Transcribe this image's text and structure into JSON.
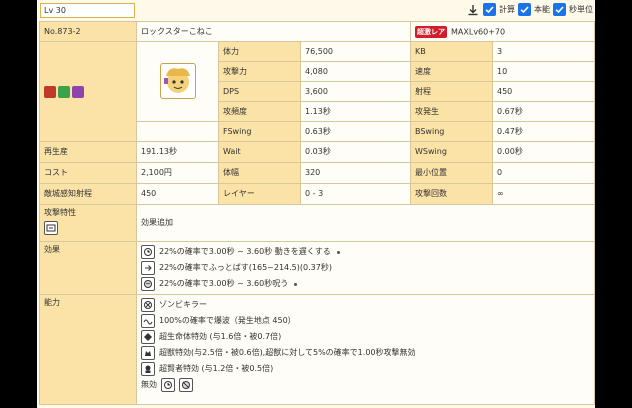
{
  "topbar": {
    "level_value": "Lv 30",
    "download_icon": "download-icon",
    "checkboxes": [
      {
        "label": "計算",
        "checked": true
      },
      {
        "label": "本能",
        "checked": true
      },
      {
        "label": "秒単位",
        "checked": true
      }
    ]
  },
  "unit": {
    "number": "No.873-2",
    "name": "ロックスターこねこ",
    "rarity_badge": "超激レア",
    "max_level": "MAXLv60+70"
  },
  "stats": {
    "hp_label": "体力",
    "hp": "76,500",
    "kb_label": "KB",
    "kb": "3",
    "atk_label": "攻撃力",
    "atk": "4,080",
    "speed_label": "速度",
    "speed": "10",
    "dps_label": "DPS",
    "dps": "3,600",
    "range_label": "射程",
    "range": "450",
    "freq_label": "攻頻度",
    "freq": "1.13秒",
    "foreswing_label": "攻発生",
    "foreswing": "0.67秒",
    "fswing_label": "FSwing",
    "fswing": "0.63秒",
    "bswing_label": "BSwing",
    "bswing": "0.47秒",
    "respawn_label": "再生産",
    "respawn": "191.13秒",
    "wait_label": "Wait",
    "wait": "0.03秒",
    "wswing_label": "WSwing",
    "wswing": "0.00秒",
    "cost_label": "コスト",
    "cost": "2,100円",
    "width_label": "体幅",
    "width": "320",
    "minpos_label": "最小位置",
    "minpos": "0",
    "detect_label": "敵城感知射程",
    "detect": "450",
    "layer_label": "レイヤー",
    "layer": "0 - 3",
    "attacks_label": "攻撃回数",
    "attacks": "∞"
  },
  "traits": {
    "label": "攻撃特性",
    "value": "効果追加"
  },
  "effects": {
    "label": "効果",
    "items": [
      "22%の確率で3.00秒 ~ 3.60秒 動きを遅くする",
      "22%の確率でふっとばす(165~214.5)(0.37秒)",
      "22%の確率で3.00秒 ~ 3.60秒呪う"
    ]
  },
  "abilities": {
    "label": "能力",
    "items": [
      "ゾンビキラー",
      "100%の確率で爆波（発生地点 450）",
      "超生命体特効 (与1.6倍・被0.7倍)",
      "超獣特効(与2.5倍・被0.6倍),超獣に対して5%の確率で1.00秒攻撃無効",
      "超賢者特効 (与1.2倍・被0.5倍)"
    ],
    "immune_label": "無効"
  },
  "colors": {
    "header_bg": "#fbe3a8",
    "value_bg": "#fffdf7",
    "border": "#d8c79a",
    "checkbox": "#1a73e8",
    "rarity_red": "#d21d2b"
  }
}
